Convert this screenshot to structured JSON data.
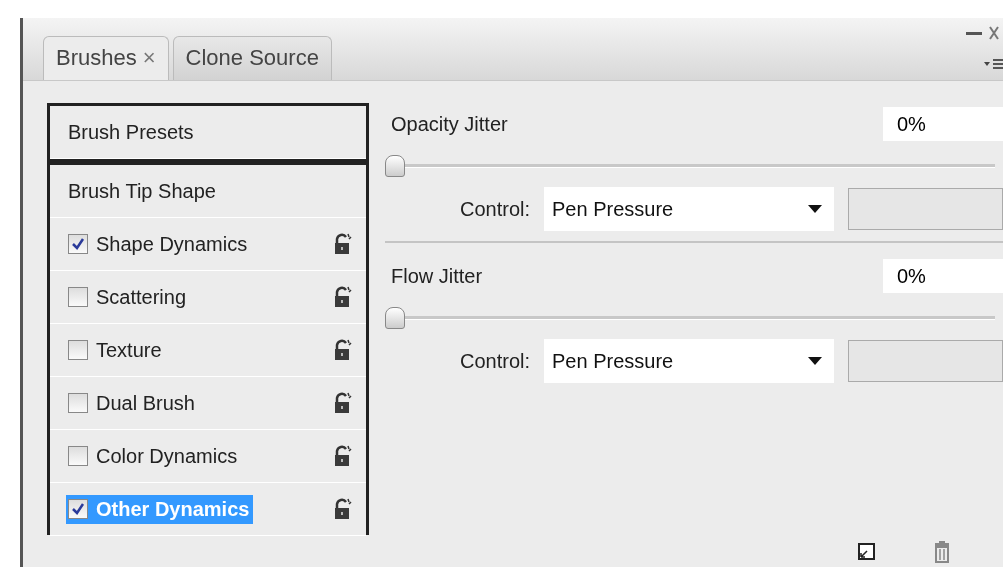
{
  "tabs": [
    {
      "label": "Brushes",
      "close": "×",
      "selected": true
    },
    {
      "label": "Clone Source",
      "selected": false
    }
  ],
  "options": [
    {
      "kind": "header",
      "label": "Brush Presets",
      "selected": false
    },
    {
      "kind": "header",
      "label": "Brush Tip Shape",
      "selected": false
    },
    {
      "kind": "option",
      "label": "Shape Dynamics",
      "checked": true,
      "selected": false
    },
    {
      "kind": "option",
      "label": "Scattering",
      "checked": false,
      "selected": false
    },
    {
      "kind": "option",
      "label": "Texture",
      "checked": false,
      "selected": false
    },
    {
      "kind": "option",
      "label": "Dual Brush",
      "checked": false,
      "selected": false
    },
    {
      "kind": "option",
      "label": "Color Dynamics",
      "checked": false,
      "selected": false
    },
    {
      "kind": "option",
      "label": "Other Dynamics",
      "checked": true,
      "selected": true
    }
  ],
  "settings": [
    {
      "label": "Opacity Jitter",
      "value": "0%",
      "level": 0,
      "control_label": "Control:",
      "control_value": "Pen Pressure",
      "extra_disabled": true
    },
    {
      "label": "Flow Jitter",
      "value": "0%",
      "level": 0,
      "control_label": "Control:",
      "control_value": "Pen Pressure",
      "extra_disabled": true
    }
  ]
}
